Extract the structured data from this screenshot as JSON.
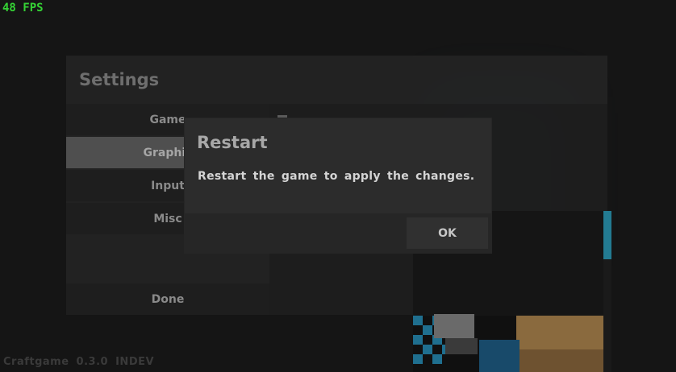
{
  "hud": {
    "fps": "48 FPS",
    "version": "Craftgame  0.3.0  INDEV"
  },
  "settings": {
    "title": "Settings",
    "nav": [
      {
        "label": "Game",
        "active": false
      },
      {
        "label": "Graphic",
        "active": true
      },
      {
        "label": "Input",
        "active": false
      },
      {
        "label": "Misc",
        "active": false
      }
    ],
    "done_label": "Done"
  },
  "dialog": {
    "title": "Restart",
    "message": "Restart the game to apply the changes.",
    "ok_label": "OK"
  },
  "colors": {
    "fps": "#35d335",
    "panel": "#242424",
    "active_nav": "#4f4f4f",
    "skin_teal": "#2aa6c8",
    "skin_tan": "#c8a060"
  }
}
